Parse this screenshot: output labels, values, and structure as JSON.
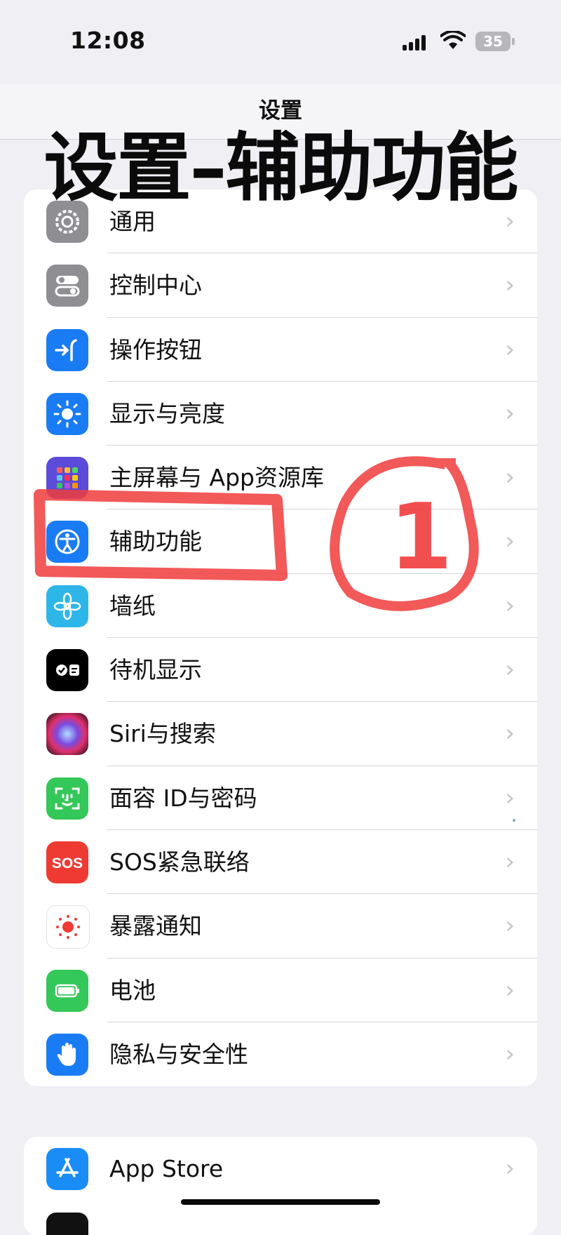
{
  "status_bar": {
    "time": "12:08",
    "battery": "35"
  },
  "header": {
    "title": "设置"
  },
  "overlay_title": "设置–辅助功能",
  "settings_group_1": [
    {
      "label": "通用",
      "icon": "gear-icon"
    },
    {
      "label": "控制中心",
      "icon": "toggles-icon"
    },
    {
      "label": "操作按钮",
      "icon": "action-button-icon"
    },
    {
      "label": "显示与亮度",
      "icon": "sun-icon"
    },
    {
      "label": "主屏幕与 App资源库",
      "icon": "app-grid-icon"
    },
    {
      "label": "辅助功能",
      "icon": "accessibility-icon"
    },
    {
      "label": "墙纸",
      "icon": "flower-icon"
    },
    {
      "label": "待机显示",
      "icon": "standby-icon"
    },
    {
      "label": "Siri与搜索",
      "icon": "siri-icon"
    },
    {
      "label": "面容 ID与密码",
      "icon": "face-id-icon"
    },
    {
      "label": "SOS紧急联络",
      "icon": "sos-icon"
    },
    {
      "label": "暴露通知",
      "icon": "exposure-icon"
    },
    {
      "label": "电池",
      "icon": "battery-icon"
    },
    {
      "label": "隐私与安全性",
      "icon": "hand-icon"
    }
  ],
  "settings_group_2": [
    {
      "label": "App Store",
      "icon": "app-store-icon"
    }
  ],
  "annotation": {
    "number": "1",
    "color": "#f03c3c"
  },
  "colors": {
    "background": "#efeff4",
    "chevron": "#c4c4c8",
    "accent_blue": "#1a7cf5"
  }
}
